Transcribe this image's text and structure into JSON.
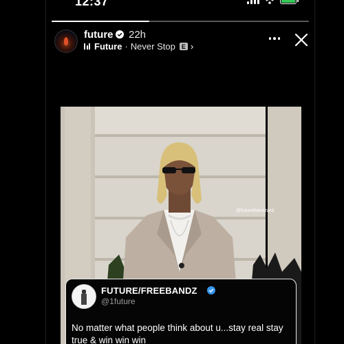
{
  "status_bar": {
    "time": "12:37"
  },
  "story": {
    "progress": 0.38,
    "username": "future",
    "time_ago": "22h",
    "music": {
      "artist": "Future",
      "separator": "·",
      "song": "Never Stop",
      "explicit_badge": "E"
    }
  },
  "post_image": {
    "watermark": "@futurethewizard"
  },
  "tweet": {
    "name": "FUTURE/FREEBANDZ",
    "handle": "@1future",
    "text": "No matter what people think about u...stay real stay true & win win win"
  },
  "colors": {
    "verified": "#3897f0",
    "battery": "#35c759",
    "background": "#000000"
  }
}
